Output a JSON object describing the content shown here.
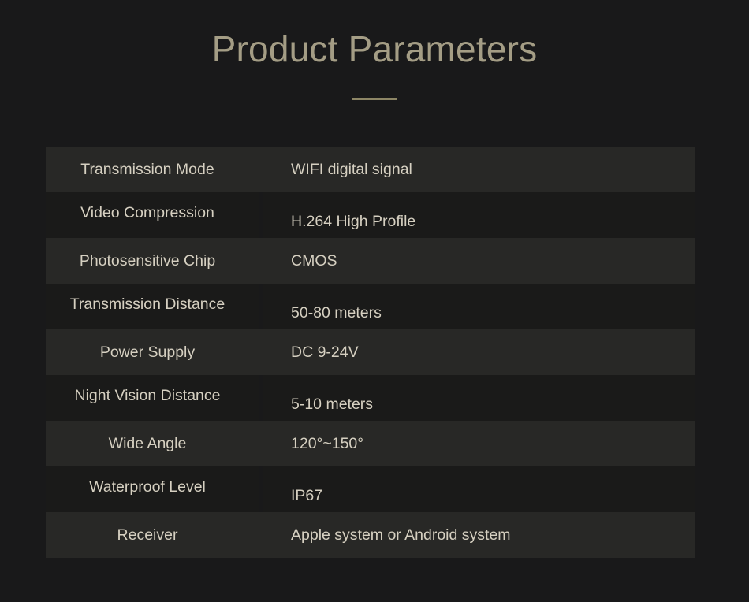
{
  "header": {
    "title": "Product Parameters",
    "divider": "title-divider",
    "title_color": "#a49d85",
    "divider_color": "#8d8666"
  },
  "theme": {
    "background": "#19191a",
    "row_light": "#282826",
    "row_dark": "#1a1a19",
    "text": "#d6d0c1"
  },
  "spec_table": {
    "rows": [
      {
        "label": "Transmission Mode",
        "value": "WIFI digital signal"
      },
      {
        "label": "Video Compression",
        "value": "H.264 High Profile"
      },
      {
        "label": "Photosensitive Chip",
        "value": "CMOS"
      },
      {
        "label": "Transmission Distance",
        "value": "50-80 meters"
      },
      {
        "label": "Power Supply",
        "value": "DC 9-24V"
      },
      {
        "label": "Night Vision Distance",
        "value": "5-10 meters"
      },
      {
        "label": "Wide Angle",
        "value": "120°~150°"
      },
      {
        "label": "Waterproof Level",
        "value": "IP67"
      },
      {
        "label": "Receiver",
        "value": "Apple system or Android system"
      }
    ]
  }
}
